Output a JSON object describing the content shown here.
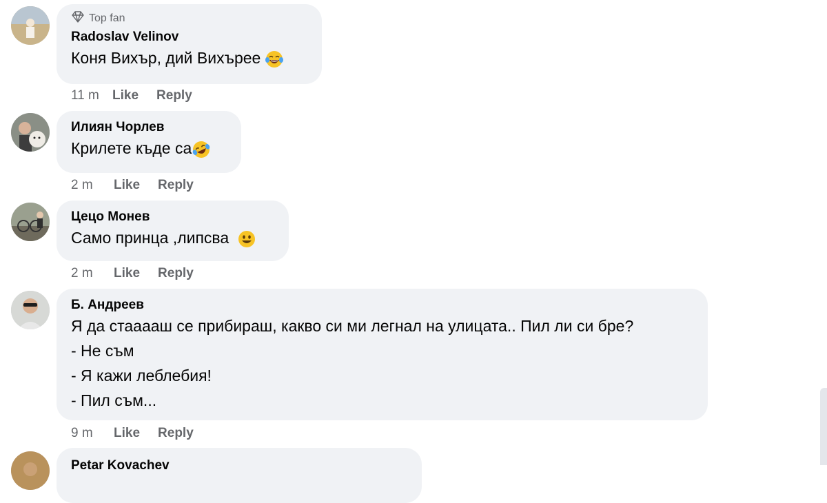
{
  "comments": [
    {
      "badge": "Top fan",
      "author": "Radoslav Velinov",
      "lines": [
        "Коня Вихър, дий Вихърее"
      ],
      "time": "11 m",
      "like": "Like",
      "reply": "Reply"
    },
    {
      "author": "Илиян Чорлев",
      "lines": [
        "Крилете къде са"
      ],
      "time": "2 m",
      "like": "Like",
      "reply": "Reply"
    },
    {
      "author": "Цецо Монев",
      "lines": [
        "Само принца ,липсва"
      ],
      "time": "2 m",
      "like": "Like",
      "reply": "Reply"
    },
    {
      "author": "Б. Андреев",
      "lines": [
        "Я да стааааш се прибираш, какво си ми легнал на улицата.. Пил ли си бре?",
        "- Не съм",
        "- Я кажи леблебия!",
        "- Пил съм..."
      ],
      "time": "9 m",
      "like": "Like",
      "reply": "Reply"
    },
    {
      "author": "Petar Kovachev"
    }
  ],
  "colors": {
    "bubble": "#f0f2f5",
    "meta": "#65676b",
    "text": "#050505"
  },
  "icons": {
    "badge": "diamond-icon",
    "emoji_1": "laughing-tears-emoji",
    "emoji_2": "rolling-laughing-emoji",
    "emoji_3": "smiley-emoji"
  }
}
